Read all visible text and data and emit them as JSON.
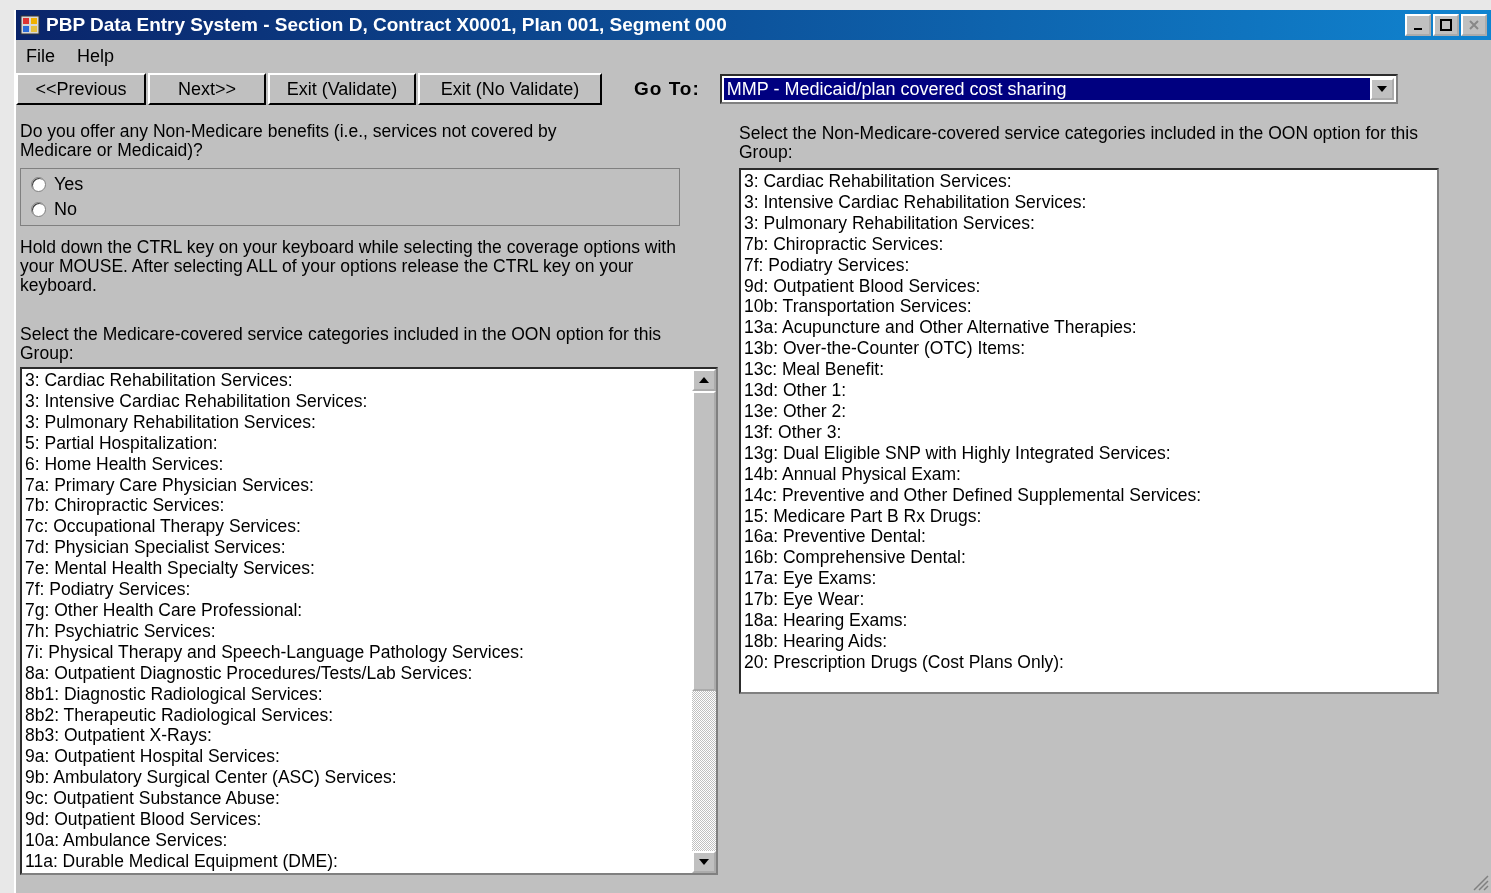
{
  "window": {
    "title": "PBP Data Entry System - Section D, Contract X0001, Plan 001, Segment 000"
  },
  "menu": [
    "File",
    "Help"
  ],
  "toolbar": {
    "buttons": [
      "<<Previous",
      "Next>>",
      "Exit (Validate)",
      "Exit (No Validate)"
    ],
    "goto_label": "Go To:",
    "goto_value": "MMP - Medicaid/plan covered cost sharing"
  },
  "question": "Do you offer any Non-Medicare benefits (i.e., services not covered by Medicare or Medicaid)?",
  "options": [
    {
      "label": "Yes",
      "selected": false
    },
    {
      "label": "No",
      "selected": false
    }
  ],
  "instructions": "Hold down the CTRL key on your keyboard while selecting the coverage options with your MOUSE. After selecting ALL  of your options release the CTRL key on your keyboard.",
  "medicare_list": {
    "label": "Select the Medicare-covered service categories included in the OON option for this Group:",
    "items": [
      "3: Cardiac Rehabilitation Services:",
      "3: Intensive Cardiac Rehabilitation Services:",
      "3: Pulmonary Rehabilitation Services:",
      "5: Partial Hospitalization:",
      "6: Home Health Services:",
      "7a: Primary Care Physician Services:",
      "7b: Chiropractic Services:",
      "7c: Occupational Therapy Services:",
      "7d: Physician Specialist Services:",
      "7e: Mental Health Specialty Services:",
      "7f: Podiatry Services:",
      "7g: Other Health Care Professional:",
      "7h: Psychiatric Services:",
      "7i: Physical Therapy and Speech-Language Pathology Services:",
      "8a: Outpatient Diagnostic Procedures/Tests/Lab Services:",
      "8b1: Diagnostic Radiological Services:",
      "8b2: Therapeutic Radiological Services:",
      "8b3: Outpatient X-Rays:",
      "9a: Outpatient Hospital Services:",
      "9b: Ambulatory Surgical Center (ASC) Services:",
      "9c: Outpatient Substance Abuse:",
      "9d: Outpatient Blood Services:",
      "10a: Ambulance Services:",
      "11a: Durable Medical Equipment (DME):"
    ]
  },
  "non_medicare_list": {
    "label": "Select the Non-Medicare-covered service categories included in the OON option for this Group:",
    "items": [
      "3: Cardiac Rehabilitation Services:",
      "3: Intensive Cardiac Rehabilitation Services:",
      "3: Pulmonary Rehabilitation Services:",
      "7b: Chiropractic Services:",
      "7f: Podiatry Services:",
      "9d: Outpatient Blood Services:",
      "10b: Transportation Services:",
      "13a: Acupuncture and Other Alternative Therapies:",
      "13b: Over-the-Counter (OTC) Items:",
      "13c: Meal Benefit:",
      "13d: Other 1:",
      "13e: Other 2:",
      "13f: Other 3:",
      "13g: Dual Eligible SNP with Highly Integrated Services:",
      "14b: Annual Physical Exam:",
      "14c: Preventive and Other Defined Supplemental Services:",
      "15: Medicare Part B Rx Drugs:",
      "16a: Preventive Dental:",
      "16b: Comprehensive Dental:",
      "17a: Eye Exams:",
      "17b: Eye Wear:",
      "18a: Hearing Exams:",
      "18b: Hearing Aids:",
      "20: Prescription Drugs (Cost Plans Only):"
    ]
  }
}
